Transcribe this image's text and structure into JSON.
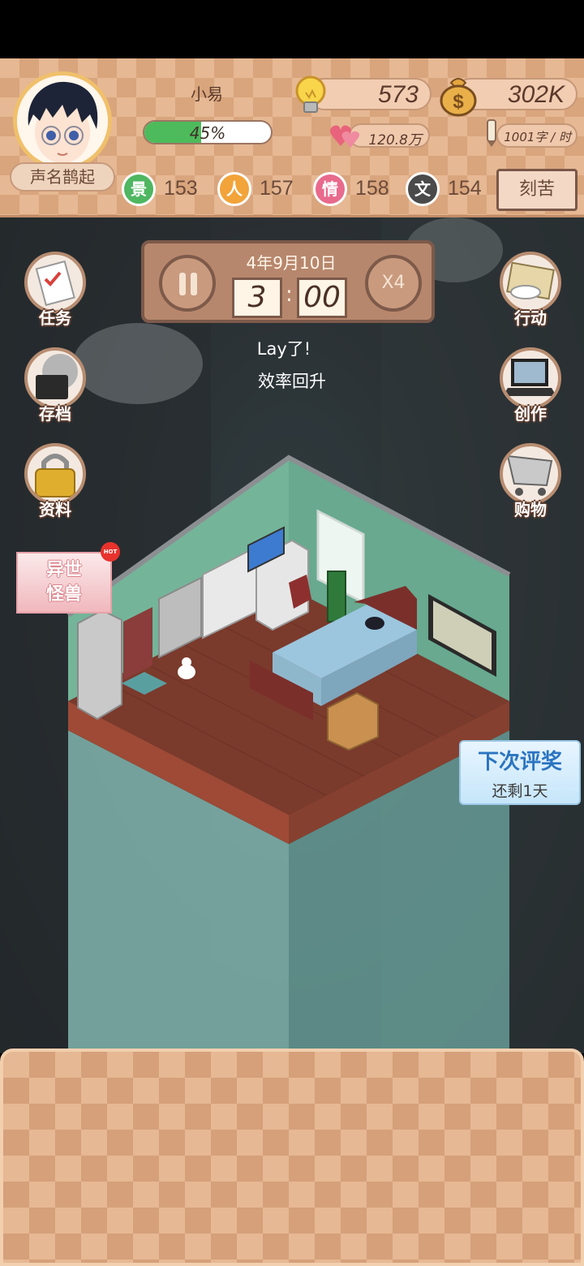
{
  "player": {
    "name": "小易",
    "fame_title": "声名鹊起",
    "progress_label": "45%",
    "progress_fraction": 0.45
  },
  "resources": {
    "ideas": "573",
    "money": "302K",
    "fans": "120.8万",
    "writing_speed": "1001字 / 时"
  },
  "stats": [
    {
      "icon_char": "景",
      "value": "153",
      "color": "#4fb661"
    },
    {
      "icon_char": "人",
      "value": "157",
      "color": "#f2a43a"
    },
    {
      "icon_char": "情",
      "value": "158",
      "color": "#e86a8c"
    },
    {
      "icon_char": "文",
      "value": "154",
      "color": "#4a4a4a"
    }
  ],
  "suffer_button": "刻苦",
  "clock": {
    "date": "4年9月10日",
    "hour": "3",
    "minute": "00",
    "speed": "X4"
  },
  "notice": {
    "line1": "Lay了!",
    "line2": "效率回升"
  },
  "left_menu": [
    {
      "label": "任务",
      "icon": "task-icon"
    },
    {
      "label": "存档",
      "icon": "save-icon"
    },
    {
      "label": "资料",
      "icon": "lock-icon"
    }
  ],
  "right_menu": [
    {
      "label": "行动",
      "icon": "action-icon"
    },
    {
      "label": "创作",
      "icon": "laptop-icon"
    },
    {
      "label": "购物",
      "icon": "cart-icon"
    }
  ],
  "event_button": {
    "line1": "异世",
    "line2": "怪兽",
    "badge": "HOT"
  },
  "award": {
    "title": "下次评奖",
    "remaining": "还剩1天"
  },
  "colors": {
    "wall": "#74b59a",
    "floor": "#6e3428",
    "panel": "#e6b893"
  }
}
